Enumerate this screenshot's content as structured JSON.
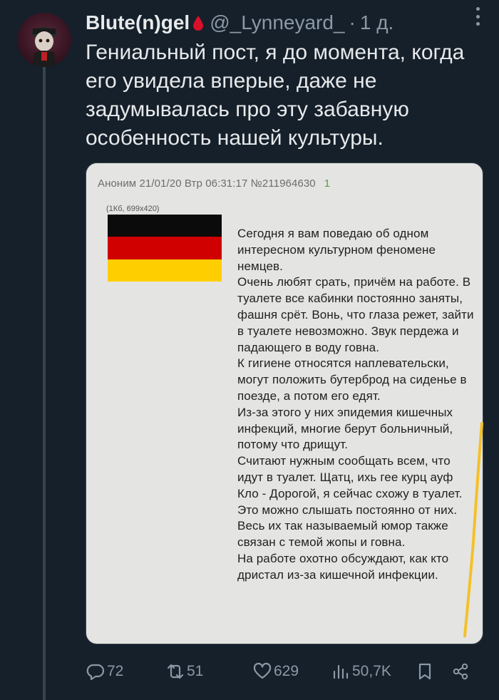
{
  "tweet": {
    "display_name": "Blute(n)gel",
    "handle": "@_Lynneyard_",
    "separator": "·",
    "time": "1 д.",
    "text": "Гениальный пост, я до момента, когда его увидела вперые, даже не задумывалась про эту забавную особенность нашей культуры."
  },
  "embedded_post": {
    "header": "Аноним 21/01/20 Втр 06:31:17 №211964630",
    "reply_count": "1",
    "file_info": "(1Кб, 699x420)",
    "flag_colors": [
      "#0b0b0b",
      "#d00000",
      "#ffce00"
    ],
    "paragraphs": [
      "Сегодня я вам поведаю об одном интересном культурном феномене немцев.",
      "Очень любят срать, причём на работе. В туалете все кабинки постоянно заняты, фашня срёт. Вонь, что глаза режет, зайти в туалете невозможно. Звук пердежа и падающего в воду говна.",
      "К гигиене относятся наплевательски, могут положить бутерброд на сиденье в поезде, а потом его едят.",
      "Из-за этого у них эпидемия кишечных инфекций, многие берут больничный, потому что дрищут.",
      "Считают нужным сообщать всем, что идут в туалет. Щатц, ихь гее курц ауф Кло - Дорогой, я сейчас схожу в туалет. Это можно слышать постоянно от них.",
      "Весь их так называемый юмор также связан с темой жопы и говна.",
      "На работе охотно обсуждают, как кто дристал из-за кишечной инфекции."
    ]
  },
  "actions": {
    "reply_count": "72",
    "retweet_count": "51",
    "like_count": "629",
    "views_count": "50,7K"
  },
  "colors": {
    "background": "#15202b",
    "secondary_text": "#8b98a5",
    "highlight_stroke": "#f5c02a"
  }
}
